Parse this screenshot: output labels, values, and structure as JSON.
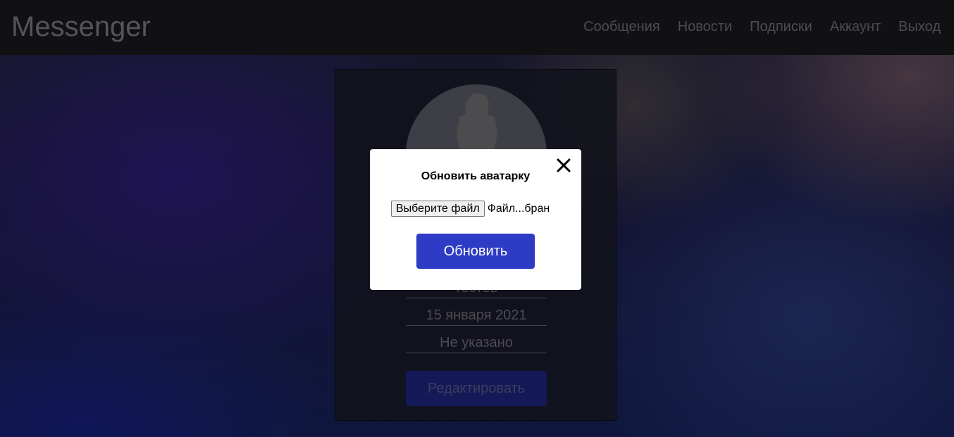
{
  "header": {
    "brand": "Messenger",
    "nav": [
      {
        "label": "Сообщения"
      },
      {
        "label": "Новости"
      },
      {
        "label": "Подписки"
      },
      {
        "label": "Аккаунт"
      },
      {
        "label": "Выход"
      }
    ]
  },
  "profile": {
    "fields": [
      {
        "value": "тестов"
      },
      {
        "value": "15 января 2021"
      },
      {
        "value": "Не указано"
      }
    ],
    "edit_label": "Редактировать"
  },
  "modal": {
    "title": "Обновить аватарку",
    "file_button_label": "Выберите файл",
    "file_status": "Файл...бран",
    "submit_label": "Обновить",
    "close_icon": "close-icon"
  },
  "colors": {
    "accent": "#2e3bc4",
    "navbar": "#1f1f23"
  }
}
